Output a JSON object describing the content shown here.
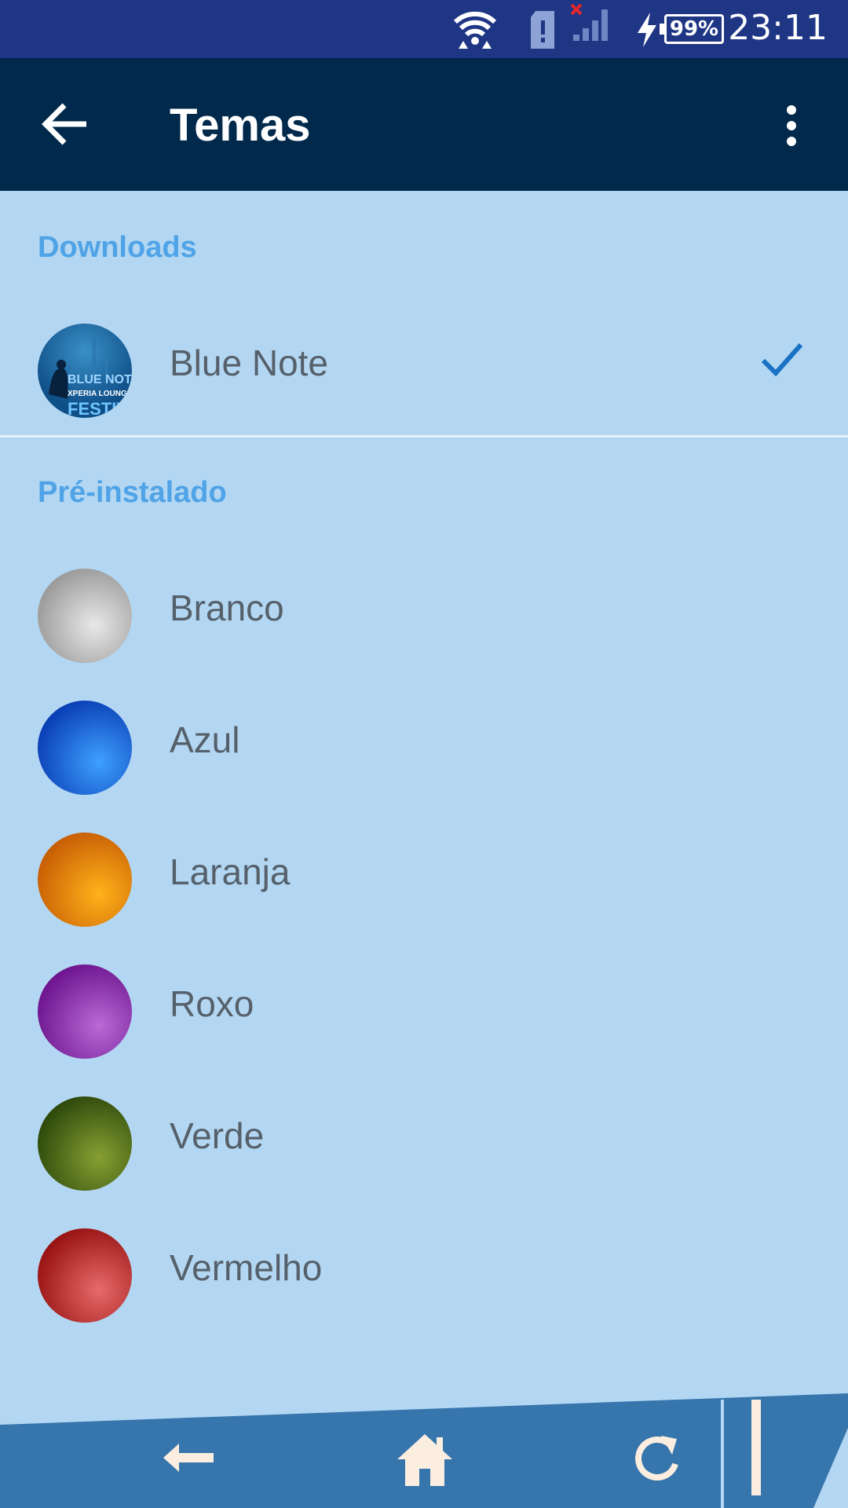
{
  "status_bar": {
    "time": "23:11",
    "battery": "99%",
    "icons": [
      "wifi-icon",
      "sim-alert-icon",
      "signal-no-service-icon",
      "charging-icon",
      "battery-icon"
    ]
  },
  "app_bar": {
    "title": "Temas",
    "back_icon": "arrow-left-icon",
    "menu_icon": "more-vert-icon"
  },
  "sections": {
    "downloads": {
      "header": "Downloads",
      "items": [
        {
          "label": "Blue Note",
          "thumb_text": [
            "BLUE NOTE",
            "XPERIA LOUNGE",
            "FESTIV"
          ],
          "selected": true
        }
      ]
    },
    "preinstalled": {
      "header": "Pré-instalado",
      "items": [
        {
          "label": "Branco",
          "color": "#b9b9b9"
        },
        {
          "label": "Azul",
          "color": "#1565e6"
        },
        {
          "label": "Laranja",
          "color": "#f08c0a"
        },
        {
          "label": "Roxo",
          "color": "#8c2fb0"
        },
        {
          "label": "Verde",
          "color": "#4f6b1a"
        },
        {
          "label": "Vermelho",
          "color": "#c2302e"
        }
      ]
    }
  },
  "colors": {
    "background": "#b3d7f2",
    "status_bar": "#1f3685",
    "app_bar": "#00294c",
    "section_header": "#4fa3e6",
    "check": "#1a72c4",
    "nav_bar": "#3775ad"
  },
  "nav_bar": {
    "buttons": [
      "nav-back-icon",
      "nav-home-icon",
      "nav-recents-icon",
      "nav-panel-icon"
    ]
  }
}
